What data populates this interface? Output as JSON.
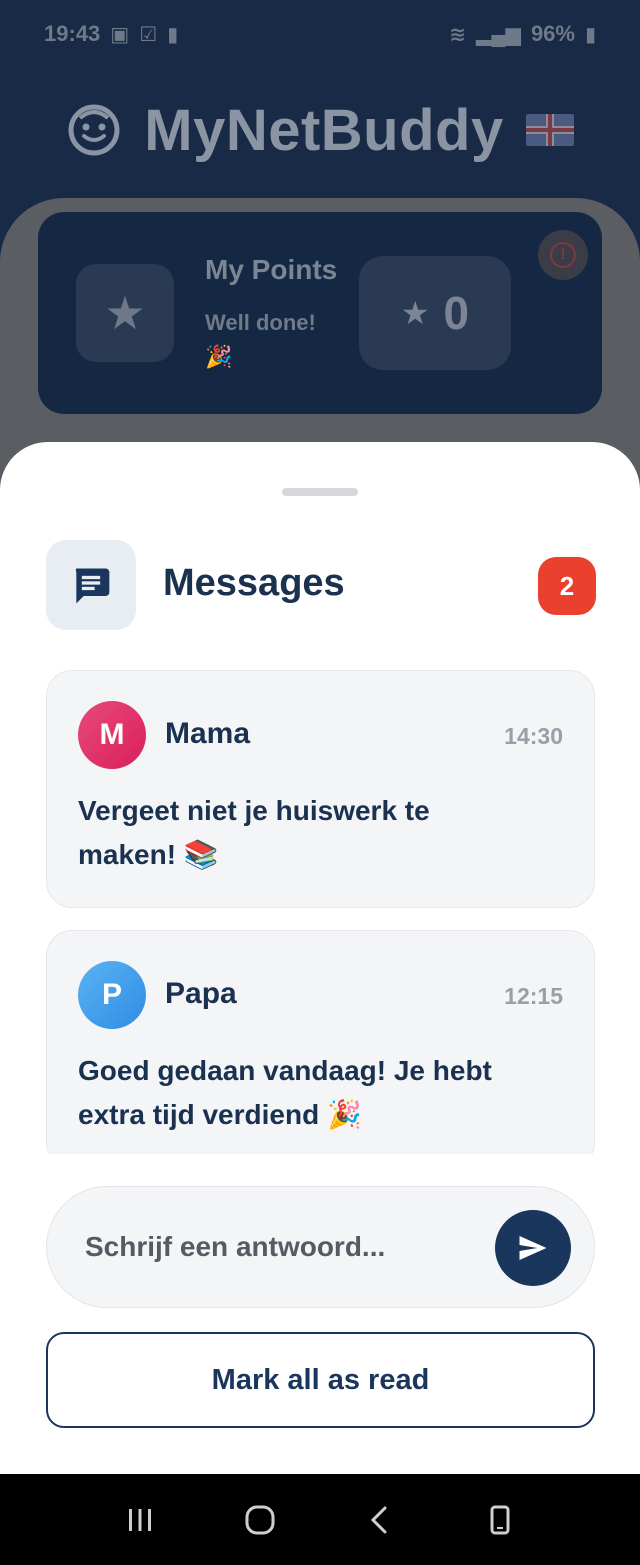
{
  "status_bar": {
    "time": "19:43",
    "battery": "96%",
    "icons": [
      "image-icon",
      "check-icon",
      "lock-icon",
      "wifi-icon",
      "signal-icon",
      "battery-icon"
    ]
  },
  "app": {
    "title": "MyNetBuddy",
    "language_flag": "uk-flag-icon"
  },
  "points_card": {
    "title": "My Points",
    "subtitle": "Well done! 🎉",
    "score": "0"
  },
  "sheet": {
    "title": "Messages",
    "unread_count": "2",
    "messages": [
      {
        "avatar_letter": "M",
        "sender": "Mama",
        "time": "14:30",
        "text": "Vergeet niet je huiswerk te maken! 📚",
        "avatar_color": "#e2356e"
      },
      {
        "avatar_letter": "P",
        "sender": "Papa",
        "time": "12:15",
        "text": "Goed gedaan vandaag! Je hebt extra tijd verdiend 🎉",
        "avatar_color": "#3d9bec"
      }
    ],
    "reply_placeholder": "Schrijf een antwoord...",
    "mark_all_label": "Mark all as read"
  },
  "colors": {
    "primary": "#1b365c",
    "badge": "#e9412e",
    "card_bg": "#f4f5f7"
  }
}
